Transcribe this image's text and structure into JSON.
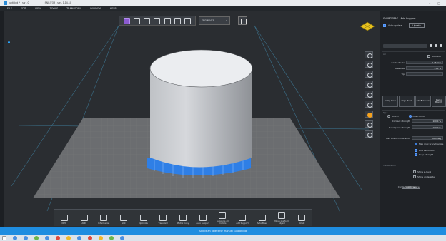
{
  "titlebar": {
    "file": "untitled * - sw - 0",
    "app": "SNILITO3 - sw - 1.14.10",
    "minimize": "–",
    "close": "□"
  },
  "menu": [
    "FILE",
    "EDIT",
    "VIEW",
    "TOOLS",
    "TRANSFORM",
    "WINDOW",
    "HELP"
  ],
  "toptool": {
    "select_value": "SEGMENTS",
    "select_chevron": "▾"
  },
  "bottombar": {
    "items": [
      {
        "label": "NEW",
        "icon": "new-icon"
      },
      {
        "label": "ADD",
        "icon": "add-icon"
      },
      {
        "label": "Information",
        "icon": "info-icon"
      },
      {
        "label": "Slot",
        "icon": "slot-icon"
      },
      {
        "label": "Optimize",
        "icon": "optimize-icon"
      },
      {
        "label": "Transform",
        "icon": "transform-icon"
      },
      {
        "label": "Matrix Copy",
        "icon": "matrix-copy-icon"
      },
      {
        "label": "Auto Support",
        "icon": "auto-support-icon"
      },
      {
        "label": "Supports all models",
        "icon": "supports-all-icon"
      },
      {
        "label": "Add Support",
        "icon": "add-support-icon"
      },
      {
        "label": "Auto Base",
        "icon": "auto-base-icon"
      },
      {
        "label": "Move platform object",
        "icon": "move-platform-icon"
      },
      {
        "label": "BUILD",
        "icon": "build-icon"
      }
    ]
  },
  "status": "Select an object for manual supporting",
  "panel": {
    "title": "SNURGERAS - Add Support",
    "auto_update_label": "Auto update",
    "update_label": "Update",
    "section_general": "Air",
    "tip_label": "Tip",
    "tip_value": "",
    "autosize_label": "Autosize",
    "contact_size_label": "Contact size",
    "contact_size_value": "0.35 mm",
    "base_size_label": "Base size",
    "base_size_value": "1.00 %",
    "buttons": [
      "Comp Tools",
      "Align Trunk",
      "Add Branches",
      "Remo Branch"
    ],
    "section_type": "Type",
    "round_label": "Round",
    "dead_point_label": "Dead Point",
    "contact_strength_label": "Contact strength",
    "contact_strength_value": "100.0 %",
    "dead_point_strength_label": "Dead point strength",
    "dead_point_strength_value": "100.0 %",
    "max_branch_label": "Max branch inclination",
    "max_branch_value": "30.0 deg",
    "max_branch_angle_label": "Max max branch angle",
    "low_resolution_label": "Low Resolution",
    "keep_straight_label": "Keep straight",
    "section_visual": "Visualization",
    "show_overhang_label": "Show Z-level",
    "show_underside_label": "Show underside",
    "contact_spacing_label": "Contact point spacer",
    "contact_spacing_value": "2.000 mm"
  }
}
